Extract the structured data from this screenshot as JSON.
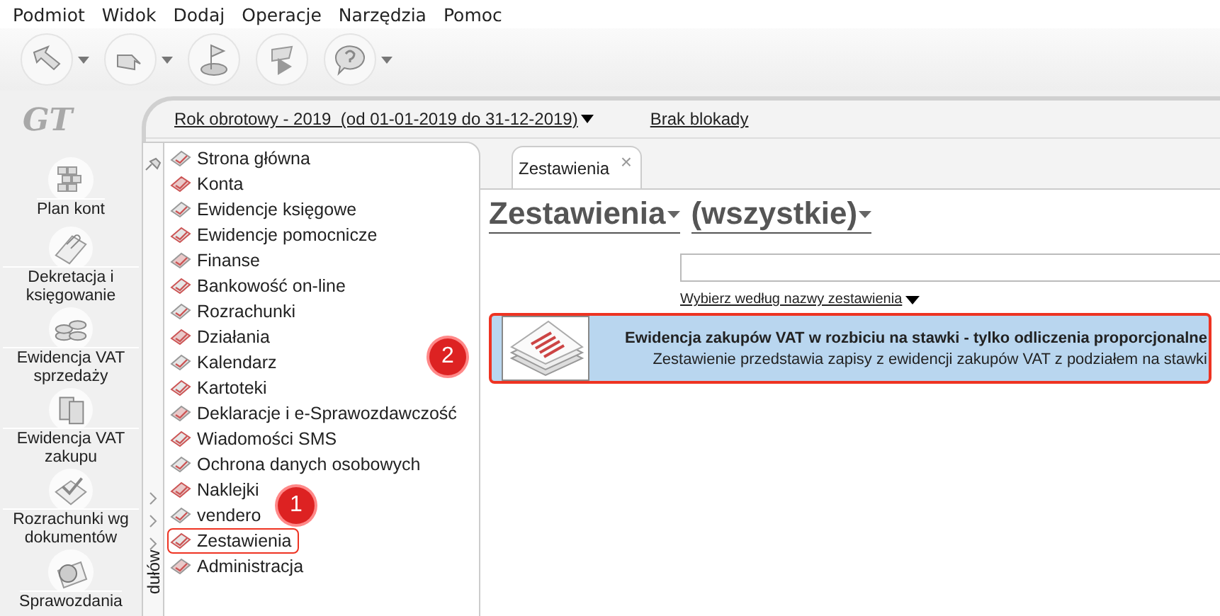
{
  "menu_bar": [
    "Podmiot",
    "Widok",
    "Dodaj",
    "Operacje",
    "Narzędzia",
    "Pomoc"
  ],
  "toolbar": [
    {
      "kind": "back",
      "dropdown": true
    },
    {
      "kind": "forward",
      "dropdown": true
    },
    {
      "kind": "flag",
      "dropdown": false
    },
    {
      "kind": "play",
      "dropdown": false
    },
    {
      "kind": "help",
      "dropdown": true
    }
  ],
  "logo": "GT",
  "shortcuts": [
    {
      "label": "Plan kont",
      "kind": "grid"
    },
    {
      "label": "Dekretacja i księgowanie",
      "kind": "clip"
    },
    {
      "label": "Ewidencja VAT sprzedaży",
      "kind": "coins"
    },
    {
      "label": "Ewidencja VAT zakupu",
      "kind": "boxes"
    },
    {
      "label": "Rozrachunki wg dokumentów",
      "kind": "check"
    },
    {
      "label": "Sprawozdania",
      "kind": "pie"
    }
  ],
  "period_selector": "Rok obrotowy - 2019  (od 01-01-2019 do 31-12-2019)",
  "lock_link": "Brak blokady",
  "modules_panel": {
    "tab_label": "dułów",
    "items": [
      {
        "label": "Strona główna",
        "highlighted": false
      },
      {
        "label": "Konta",
        "highlighted": false
      },
      {
        "label": "Ewidencje księgowe",
        "highlighted": false
      },
      {
        "label": "Ewidencje pomocnicze",
        "highlighted": false
      },
      {
        "label": "Finanse",
        "highlighted": false
      },
      {
        "label": "Bankowość on-line",
        "highlighted": false
      },
      {
        "label": "Rozrachunki",
        "highlighted": false
      },
      {
        "label": "Działania",
        "highlighted": false
      },
      {
        "label": "Kalendarz",
        "highlighted": false
      },
      {
        "label": "Kartoteki",
        "highlighted": false
      },
      {
        "label": "Deklaracje i e-Sprawozdawczość",
        "highlighted": false
      },
      {
        "label": "Wiadomości SMS",
        "highlighted": false
      },
      {
        "label": "Ochrona danych osobowych",
        "highlighted": false
      },
      {
        "label": "Naklejki",
        "highlighted": false
      },
      {
        "label": "vendero",
        "highlighted": false
      },
      {
        "label": "Zestawienia",
        "highlighted": true
      },
      {
        "label": "Administracja",
        "highlighted": false
      }
    ]
  },
  "tab": {
    "label": "Zestawienia",
    "close": "×"
  },
  "heading": {
    "category": "Zestawienia",
    "filter": "(wszystkie)"
  },
  "search_mode_link": "Wybierz według nazwy zestawienia",
  "reports": [
    {
      "title": "Ewidencja zakupów VAT w rozbiciu na stawki - tylko odliczenia proporcjonalne",
      "description": "Zestawienie przedstawia zapisy z ewidencji zakupów VAT z podziałem na stawki",
      "selected": true,
      "highlighted": true
    }
  ],
  "annotations": [
    {
      "label": "1"
    },
    {
      "label": "2"
    }
  ]
}
